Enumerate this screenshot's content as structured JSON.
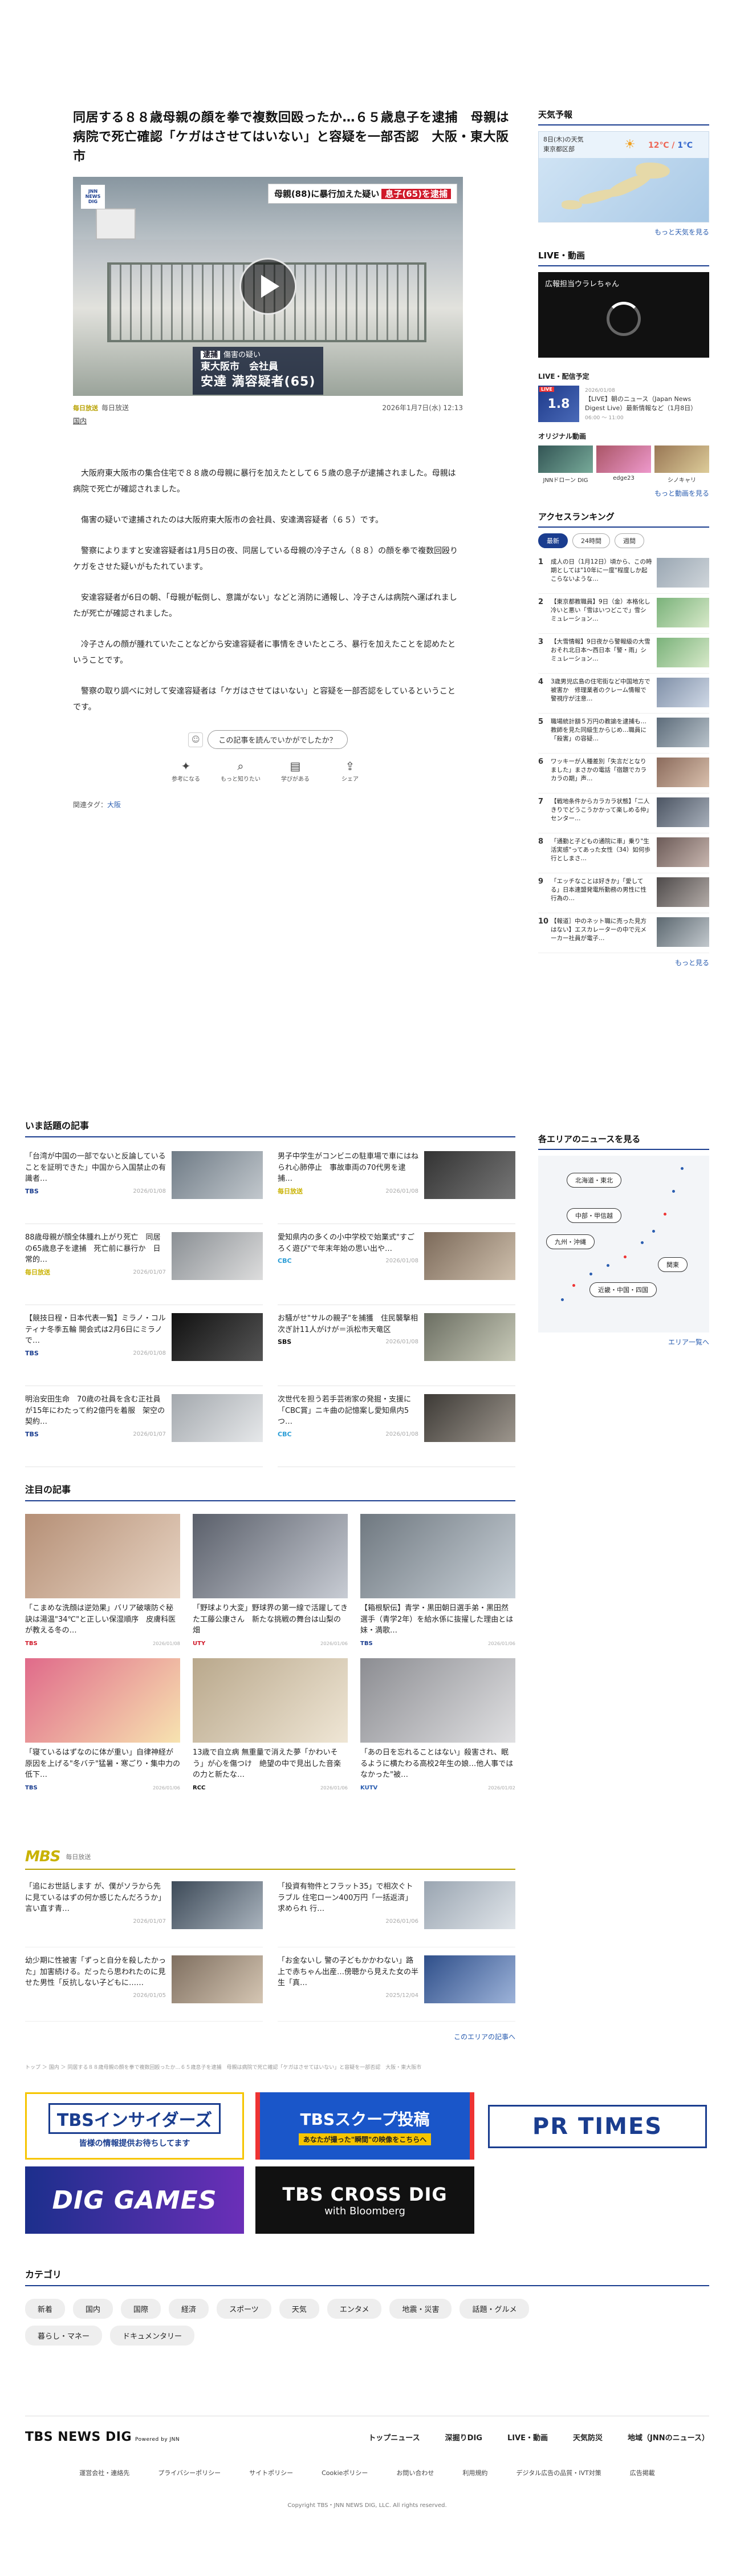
{
  "article": {
    "title": "同居する８８歳母親の顔を拳で複数回殴ったか…６５歳息子を逮捕　母親は病院で死亡確認「ケガはさせてはいない」と容疑を一部否認　大阪・東大阪市",
    "hero_logo": "JNN NEWS DIG",
    "hero_caption": "母親(88)に暴行加えた疑い",
    "hero_caption_hl": "息子(65)を逮捕",
    "hero_tag": "逮捕",
    "hero_subtitle": "傷害の疑い",
    "hero_line1": "東大阪市　会社員",
    "hero_name": "安達 満容疑者(65)",
    "source_badge": "毎日放送",
    "source": "毎日放送",
    "datetime": "2026年1月7日(水) 12:13",
    "category": "国内",
    "paragraphs": [
      "大阪府東大阪市の集合住宅で８８歳の母親に暴行を加えたとして６５歳の息子が逮捕されました。母親は病院で死亡が確認されました。",
      "傷害の疑いで逮捕されたのは大阪府東大阪市の会社員、安達満容疑者（６５）です。",
      "警察によりますと安達容疑者は1月5日の夜、同居している母親の冷子さん（８８）の顔を拳で複数回殴りケガをさせた疑いがもたれています。",
      "安達容疑者が6日の朝、「母親が転倒し、意識がない」などと消防に通報し、冷子さんは病院へ運ばれましたが死亡が確認されました。",
      "冷子さんの顔が腫れていたことなどから安達容疑者に事情をきいたところ、暴行を加えたことを認めたということです。",
      "警察の取り調べに対して安達容疑者は「ケガはさせてはいない」と容疑を一部否認をしているということです。"
    ],
    "feedback_question": "この記事を読んでいかがでしたか？",
    "feedback_buttons": [
      "参考になる",
      "もっと知りたい",
      "学びがある",
      "シェア"
    ],
    "tags_label": "関連タグ：",
    "tag": "大阪"
  },
  "sidebar": {
    "weather_title": "天気予報",
    "weather_date": "8日(木)の天気",
    "weather_place": "東京都区部",
    "weather_high": "12℃",
    "weather_low": "1℃",
    "weather_more": "もっと天気を見る",
    "live_title": "LIVE・動画",
    "live_box_title": "広報担当ウラレちゃん",
    "live_sched_title": "LIVE・配信予定",
    "live_sched_thumb": "1.8",
    "live_sched_badge": "LIVE",
    "live_sched_date": "2026/01/08",
    "live_sched_text": "【LIVE】朝のニュース（Japan News Digest Live）最新情報など（1月8日）",
    "live_sched_time": "06:00 〜 11:00",
    "orig_title": "オリジナル動画",
    "orig_items": [
      "JNNドローン DIG",
      "edge23",
      "シノキャリ"
    ],
    "live_more": "もっと動画を見る",
    "rank_title": "アクセスランキング",
    "rank_tabs": [
      "最新",
      "24時間",
      "週間"
    ],
    "rank_items": [
      "成人の日（1月12日）頃から、この時期としては\"10年に一度\"程度しか起こらないような…",
      "【東京都教職員】9日（金）本格化し冷いと悪い「雪はいつどこで」雪シミュレーション…",
      "【大雪情報】9日夜から警報級の大雪　おそれ北日本〜西日本「警・雨」シミュレーション…",
      "3歳男児広島の住宅街など中国地方で被害か　修理業者のクレーム情報で警視庁が注意…",
      "職場統計額５万円の教諭を逮捕も…教師を見た同級生からじめ…職員に「殺害」の容疑…",
      "ワッキーが人種差別「失言だとなりました」まさかの電話「宿題でカラカラの期」声…",
      "【戦地条件からカラカラ状態】「二人きりでどうこうかかって楽しめる仲」センター…",
      "「通勤と子どもの通院に車」乗り\"生活実感\"ってあった女性（34）如何歩行としまさ…",
      "「エッチなことは好きか」「愛してる」日本連盟発電所勤務の男性に性行為の…",
      "【報道］中のネット職に売った見方はない】エスカレーターの中で元メーカー社員が電子…"
    ],
    "rank_more": "もっと見る",
    "area_title": "各エリアのニュースを見る",
    "area_buttons": [
      "北海道・東北",
      "中部・甲信越",
      "九州・沖縄",
      "関東",
      "近畿・中国・四国"
    ],
    "area_more": "エリア一覧へ"
  },
  "trending": {
    "title": "いま話題の記事",
    "items": [
      {
        "text": "「台湾が中国の一部でないと反論していることを証明できた」中国から入国禁止の有識者…",
        "station": "TBS",
        "date": "2026/01/08"
      },
      {
        "text": "男子中学生がコンビニの駐車場で車にはねられ心肺停止　事故車両の70代男を逮捕…",
        "station": "毎日放送",
        "date": "2026/01/08"
      },
      {
        "text": "88歳母親が顔全体腫れ上がり死亡　同居の65歳息子を逮捕　死亡前に暴行か　日常的…",
        "station": "毎日放送",
        "date": "2026/01/07"
      },
      {
        "text": "愛知県内の多くの小中学校で始業式\"すごろく遊び\"で年末年始の思い出や…",
        "station": "CBC",
        "date": "2026/01/08"
      },
      {
        "text": "【競技日程・日本代表一覧】ミラノ・コルティナ冬季五輪 開会式は2月6日にミラノで…",
        "station": "TBS",
        "date": "2026/01/08"
      },
      {
        "text": "お騒がせ\"サルの親子\"を捕獲　住民襲撃相次ぎ計11人がけが＝浜松市天竜区",
        "station": "SBS",
        "date": "2026/01/08"
      },
      {
        "text": "明治安田生命　70歳の社員を含む正社員が15年にわたって約2億円を着服　架空の契約…",
        "station": "TBS",
        "date": "2026/01/07"
      },
      {
        "text": "次世代を担う若手芸術家の発掘・支援に「CBC賞」ニキ曲の記憶案し愛知県内5つ…",
        "station": "CBC",
        "date": "2026/01/08"
      }
    ]
  },
  "featured": {
    "title": "注目の記事",
    "items": [
      {
        "text": "「こまめな洗顔は逆効果」バリア破壊防ぐ秘訣は湯温\"34℃\"と正しい保湿順序　皮膚科医が教える冬の…",
        "station": "TBS",
        "date": "2026/01/08"
      },
      {
        "text": "「野球より大変」野球界の第一線で活躍してきた工藤公康さん　新たな挑戦の舞台は山梨の畑",
        "station": "UTY",
        "date": "2026/01/06"
      },
      {
        "text": "【箱根駅伝】青学・黒田朝日選手弟・黒田然選手（青学2年）を給水係に抜擢した理由とは　妹・満歌…",
        "station": "TBS",
        "date": "2026/01/06"
      },
      {
        "text": "「寝ているはずなのに体が重い」自律神経が原因を上げる\"冬バテ\"猛暑・寒ごり・集中力の低下…",
        "station": "TBS",
        "date": "2026/01/06"
      },
      {
        "text": "13歳で自立病 無重量で消えた夢「かわいそう」が心を傷つけ　絶望の中で見出した音楽の力と新たな…",
        "station": "RCC",
        "date": "2026/01/06"
      },
      {
        "text": "「あの日を忘れることはない」殺害され、眠るように横たわる高校2年生の娘…他人事ではなかった\"被…",
        "station": "KUTV",
        "date": "2026/01/02"
      }
    ]
  },
  "mbs": {
    "logo": "MBS",
    "label": "毎日放送",
    "items": [
      {
        "text": "「追にお世話します が、僕がソラから先に見ているはずの何か感じたんだろうか」言い直す青…",
        "date": "2026/01/07"
      },
      {
        "text": "「投資有物件とフラット35」で相次ぐトラブル 住宅ローン400万円「一括返済」求められ 行…",
        "date": "2026/01/06"
      },
      {
        "text": "幼少期に性被害「ずっと自分を殺したかった」加害続ける。だったら思われたのに見せた男性「反抗しない子どもに……",
        "date": "2026/01/05"
      },
      {
        "text": "「お金ないし 警の子どもかかわない」路上で赤ちゃん出産…傍聴から見えた女の半生「真…",
        "date": "2025/12/04"
      }
    ],
    "more": "このエリアの記事へ"
  },
  "breadcrumb": "トップ ＞ 国内 ＞ 同居する８８歳母親の顔を拳で複数回殴ったか…６５歳息子を逮捕　母親は病院で死亡確認「ケガはさせてはいない」と容疑を一部否認　大阪・東大阪市",
  "banners": {
    "b1": "TBSインサイダーズ",
    "b1_sub": "皆様の情報提供お待ちしてます",
    "b2": "TBSスクープ投稿",
    "b2_sub": "あなたが撮った\"瞬間\"の映像をこちらへ",
    "b3": "PR TIMES",
    "b4": "DIG GAMES",
    "b5": "TBS CROSS DIG",
    "b5_sub": "with Bloomberg"
  },
  "categories": {
    "title": "カテゴリ",
    "items": [
      "新着",
      "国内",
      "国際",
      "経済",
      "スポーツ",
      "天気",
      "エンタメ",
      "地震・災害",
      "話題・グルメ",
      "暮らし・マネー",
      "ドキュメンタリー"
    ]
  },
  "footer": {
    "logo": "TBS NEWS DIG",
    "logo_sub": "Powered by JNN",
    "nav": [
      "トップニュース",
      "深掘りDIG",
      "LIVE・動画",
      "天気防災",
      "地域（JNNのニュース）"
    ],
    "links": [
      "運営会社・連絡先",
      "プライバシーポリシー",
      "サイトポリシー",
      "Cookieポリシー",
      "お問い合わせ",
      "利用規約",
      "デジタル広告の品質・IVT対策",
      "広告掲載"
    ],
    "copyright": "Copyright TBS・JNN NEWS DIG, LLC. All rights reserved."
  },
  "colors": {
    "accent": "#1a3d8f",
    "mbs": "#c9b200",
    "alert": "#d0192a"
  }
}
